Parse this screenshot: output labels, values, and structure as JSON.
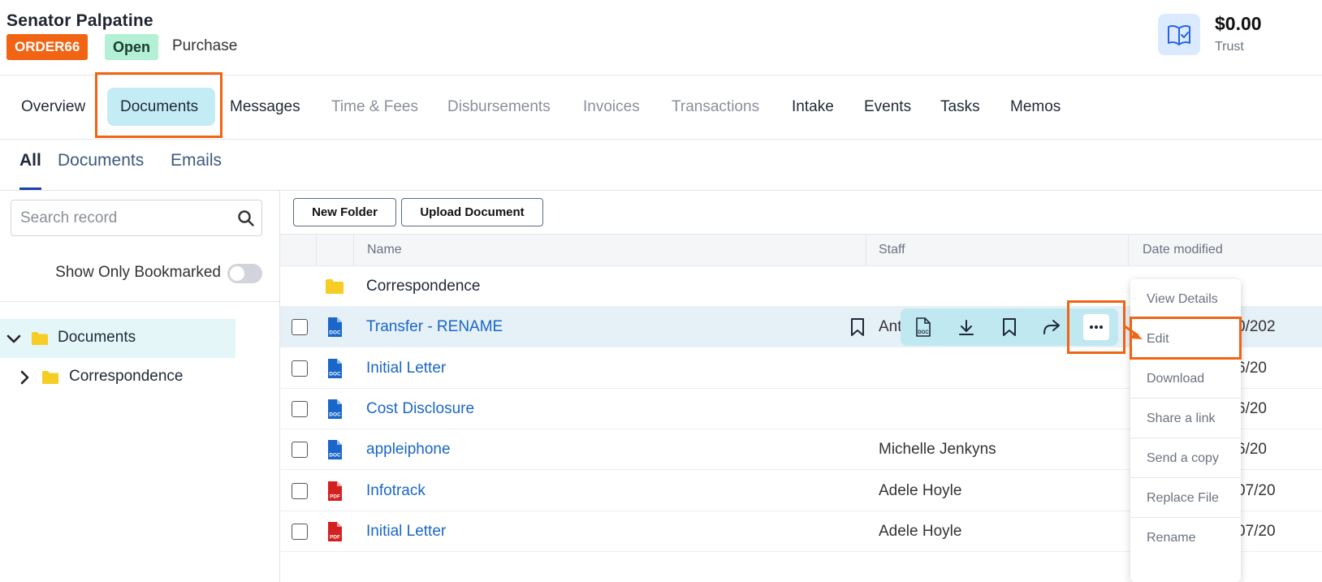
{
  "header": {
    "client_name": "Senator Palpatine",
    "order_badge": "ORDER66",
    "status_badge": "Open",
    "matter_type": "Purchase",
    "trust_amount": "$0.00",
    "trust_label": "Trust"
  },
  "main_tabs": [
    {
      "label": "Overview",
      "state": "normal"
    },
    {
      "label": "Documents",
      "state": "active"
    },
    {
      "label": "Messages",
      "state": "normal"
    },
    {
      "label": "Time & Fees",
      "state": "muted"
    },
    {
      "label": "Disbursements",
      "state": "muted"
    },
    {
      "label": "Invoices",
      "state": "muted"
    },
    {
      "label": "Transactions",
      "state": "muted"
    },
    {
      "label": "Intake",
      "state": "normal"
    },
    {
      "label": "Events",
      "state": "normal"
    },
    {
      "label": "Tasks",
      "state": "normal"
    },
    {
      "label": "Memos",
      "state": "normal"
    }
  ],
  "sub_tabs": [
    {
      "label": "All",
      "active": true
    },
    {
      "label": "Documents",
      "active": false
    },
    {
      "label": "Emails",
      "active": false
    }
  ],
  "left_panel": {
    "search_placeholder": "Search record",
    "bookmark_toggle_label": "Show Only Bookmarked",
    "bookmark_toggle_on": false,
    "tree": [
      {
        "label": "Documents",
        "expanded": true,
        "selected": true
      },
      {
        "label": "Correspondence",
        "expanded": false,
        "selected": false
      }
    ]
  },
  "toolbar": {
    "new_folder_label": "New Folder",
    "upload_label": "Upload Document"
  },
  "table": {
    "columns": [
      "Name",
      "Staff",
      "Date modified"
    ],
    "rows": [
      {
        "type": "folder",
        "name": "Correspondence",
        "staff": "",
        "date": ""
      },
      {
        "type": "doc",
        "name": "Transfer - RENAME",
        "staff": "Ant",
        "date": "0/202",
        "hover": true
      },
      {
        "type": "doc",
        "name": "Initial Letter",
        "staff": "",
        "date": "6/20"
      },
      {
        "type": "doc",
        "name": "Cost Disclosure",
        "staff": "",
        "date": "6/20"
      },
      {
        "type": "doc",
        "name": "appleiphone",
        "staff": "Michelle Jenkyns",
        "date": "6/20"
      },
      {
        "type": "pdf",
        "name": "Infotrack",
        "staff": "Adele Hoyle",
        "date": "07/20"
      },
      {
        "type": "pdf",
        "name": "Initial Letter",
        "staff": "Adele Hoyle",
        "date": "07/20"
      }
    ]
  },
  "context_menu": {
    "items": [
      "View Details",
      "Edit",
      "Download",
      "Share a link",
      "Send a copy",
      "Replace File",
      "Rename"
    ]
  },
  "colors": {
    "accent_orange": "#f06414",
    "active_tab_bg": "#c4ecf4",
    "link_blue": "#1a66c9",
    "open_badge_bg": "#b3f0d5",
    "doc_icon": "#1a66c9",
    "pdf_icon": "#d42020",
    "folder": "#f5cd24"
  },
  "icons": {
    "trust": "book-check-icon",
    "search": "search-icon",
    "tree_expanded": "chevron-down-icon",
    "tree_collapsed": "chevron-right-icon",
    "folder": "folder-icon",
    "doc": "doc-file-icon",
    "pdf": "pdf-file-icon",
    "actions": [
      "doc-file-icon",
      "download-icon",
      "bookmark-icon",
      "share-icon",
      "more-icon"
    ]
  }
}
